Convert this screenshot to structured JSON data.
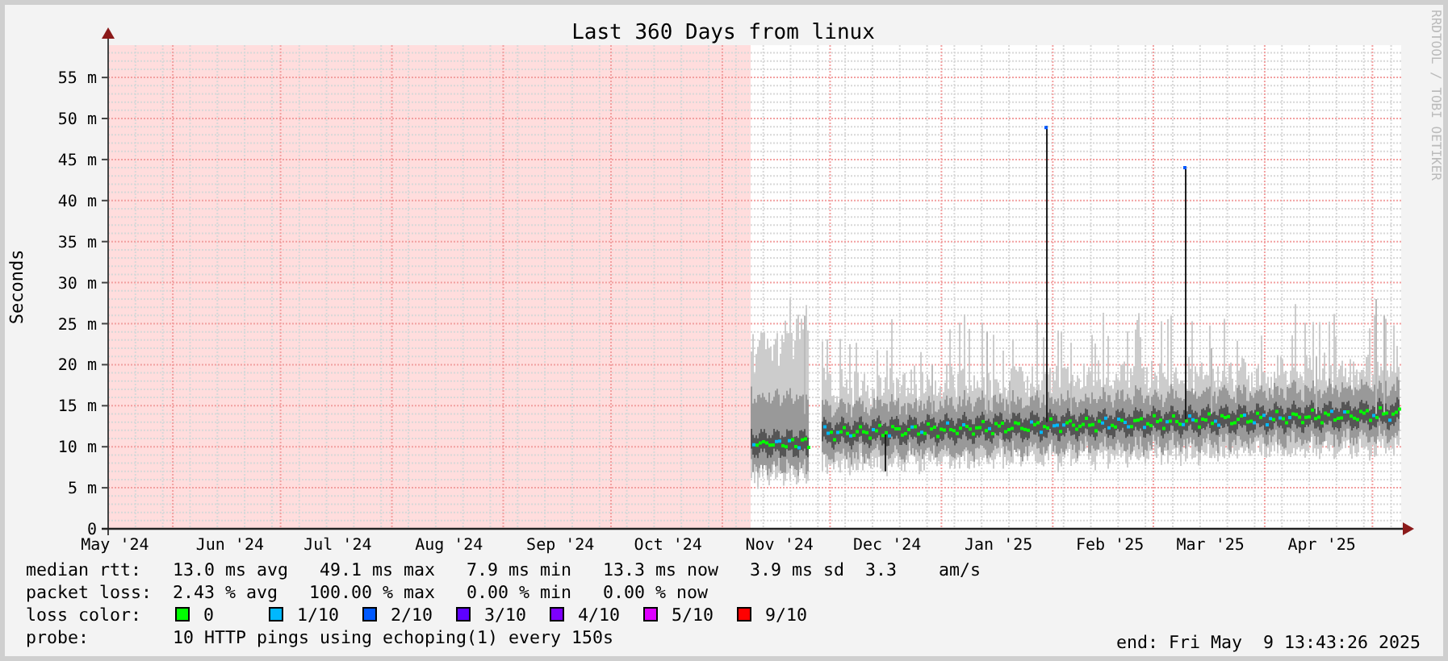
{
  "title": "Last 360 Days from linux",
  "credit": "RRDTOOL / TOBI OETIKER",
  "y_axis": {
    "label": "Seconds",
    "ticks": [
      "55 m",
      "50 m",
      "45 m",
      "40 m",
      "35 m",
      "30 m",
      "25 m",
      "20 m",
      "15 m",
      "10 m",
      "5 m",
      "0"
    ]
  },
  "x_axis": {
    "ticks": [
      "May '24",
      "Jun '24",
      "Jul '24",
      "Aug '24",
      "Sep '24",
      "Oct '24",
      "Nov '24",
      "Dec '24",
      "Jan '25",
      "Feb '25",
      "Mar '25",
      "Apr '25"
    ]
  },
  "stats": [
    {
      "label": "median rtt:",
      "values": "13.0 ms avg   49.1 ms max   7.9 ms min   13.3 ms now   3.9 ms sd  3.3    am/s"
    },
    {
      "label": "packet loss:",
      "values": "2.43 % avg   100.00 % max   0.00 % min   0.00 % now"
    }
  ],
  "loss_color": {
    "label": "loss color:",
    "items": [
      {
        "label": "0",
        "color": "#00ff00"
      },
      {
        "label": "1/10",
        "color": "#00b8ff"
      },
      {
        "label": "2/10",
        "color": "#0059ff"
      },
      {
        "label": "3/10",
        "color": "#5e00ff"
      },
      {
        "label": "4/10",
        "color": "#7e00ff"
      },
      {
        "label": "5/10",
        "color": "#dd00ff"
      },
      {
        "label": "9/10",
        "color": "#ff0000"
      }
    ]
  },
  "probe": {
    "label": "probe:",
    "value": "10 HTTP pings using echoping(1) every 150s"
  },
  "end": "end: Fri May  9 13:43:26 2025"
}
